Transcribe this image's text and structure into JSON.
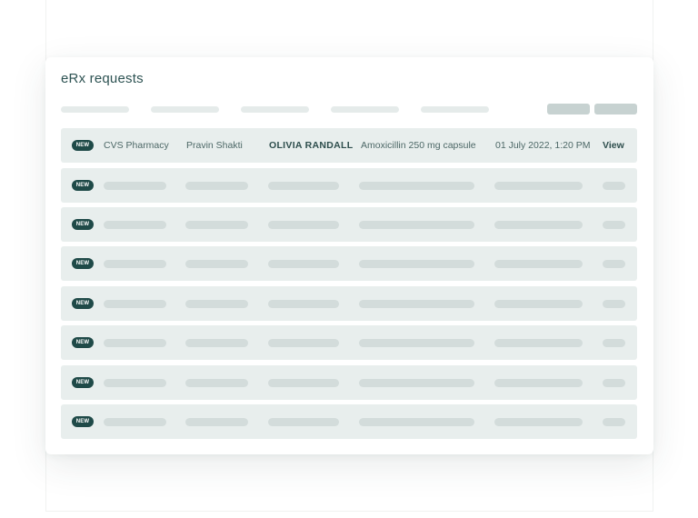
{
  "panel": {
    "title": "eRx requests"
  },
  "table": {
    "rows": [
      {
        "badge": "NEW",
        "pharmacy": "CVS Pharmacy",
        "prescriber": "Pravin Shakti",
        "patient": "OLIVIA RANDALL",
        "medication": "Amoxicillin 250 mg capsule",
        "datetime": "01 July 2022, 1:20 PM",
        "action": "View"
      },
      {
        "badge": "NEW"
      },
      {
        "badge": "NEW"
      },
      {
        "badge": "NEW"
      },
      {
        "badge": "NEW"
      },
      {
        "badge": "NEW"
      },
      {
        "badge": "NEW"
      },
      {
        "badge": "NEW"
      }
    ]
  },
  "colors": {
    "title": "#2e5353",
    "badge_bg": "#1f4a48",
    "row_bg": "#e8eeed",
    "skeleton": "#d3dcdb"
  }
}
